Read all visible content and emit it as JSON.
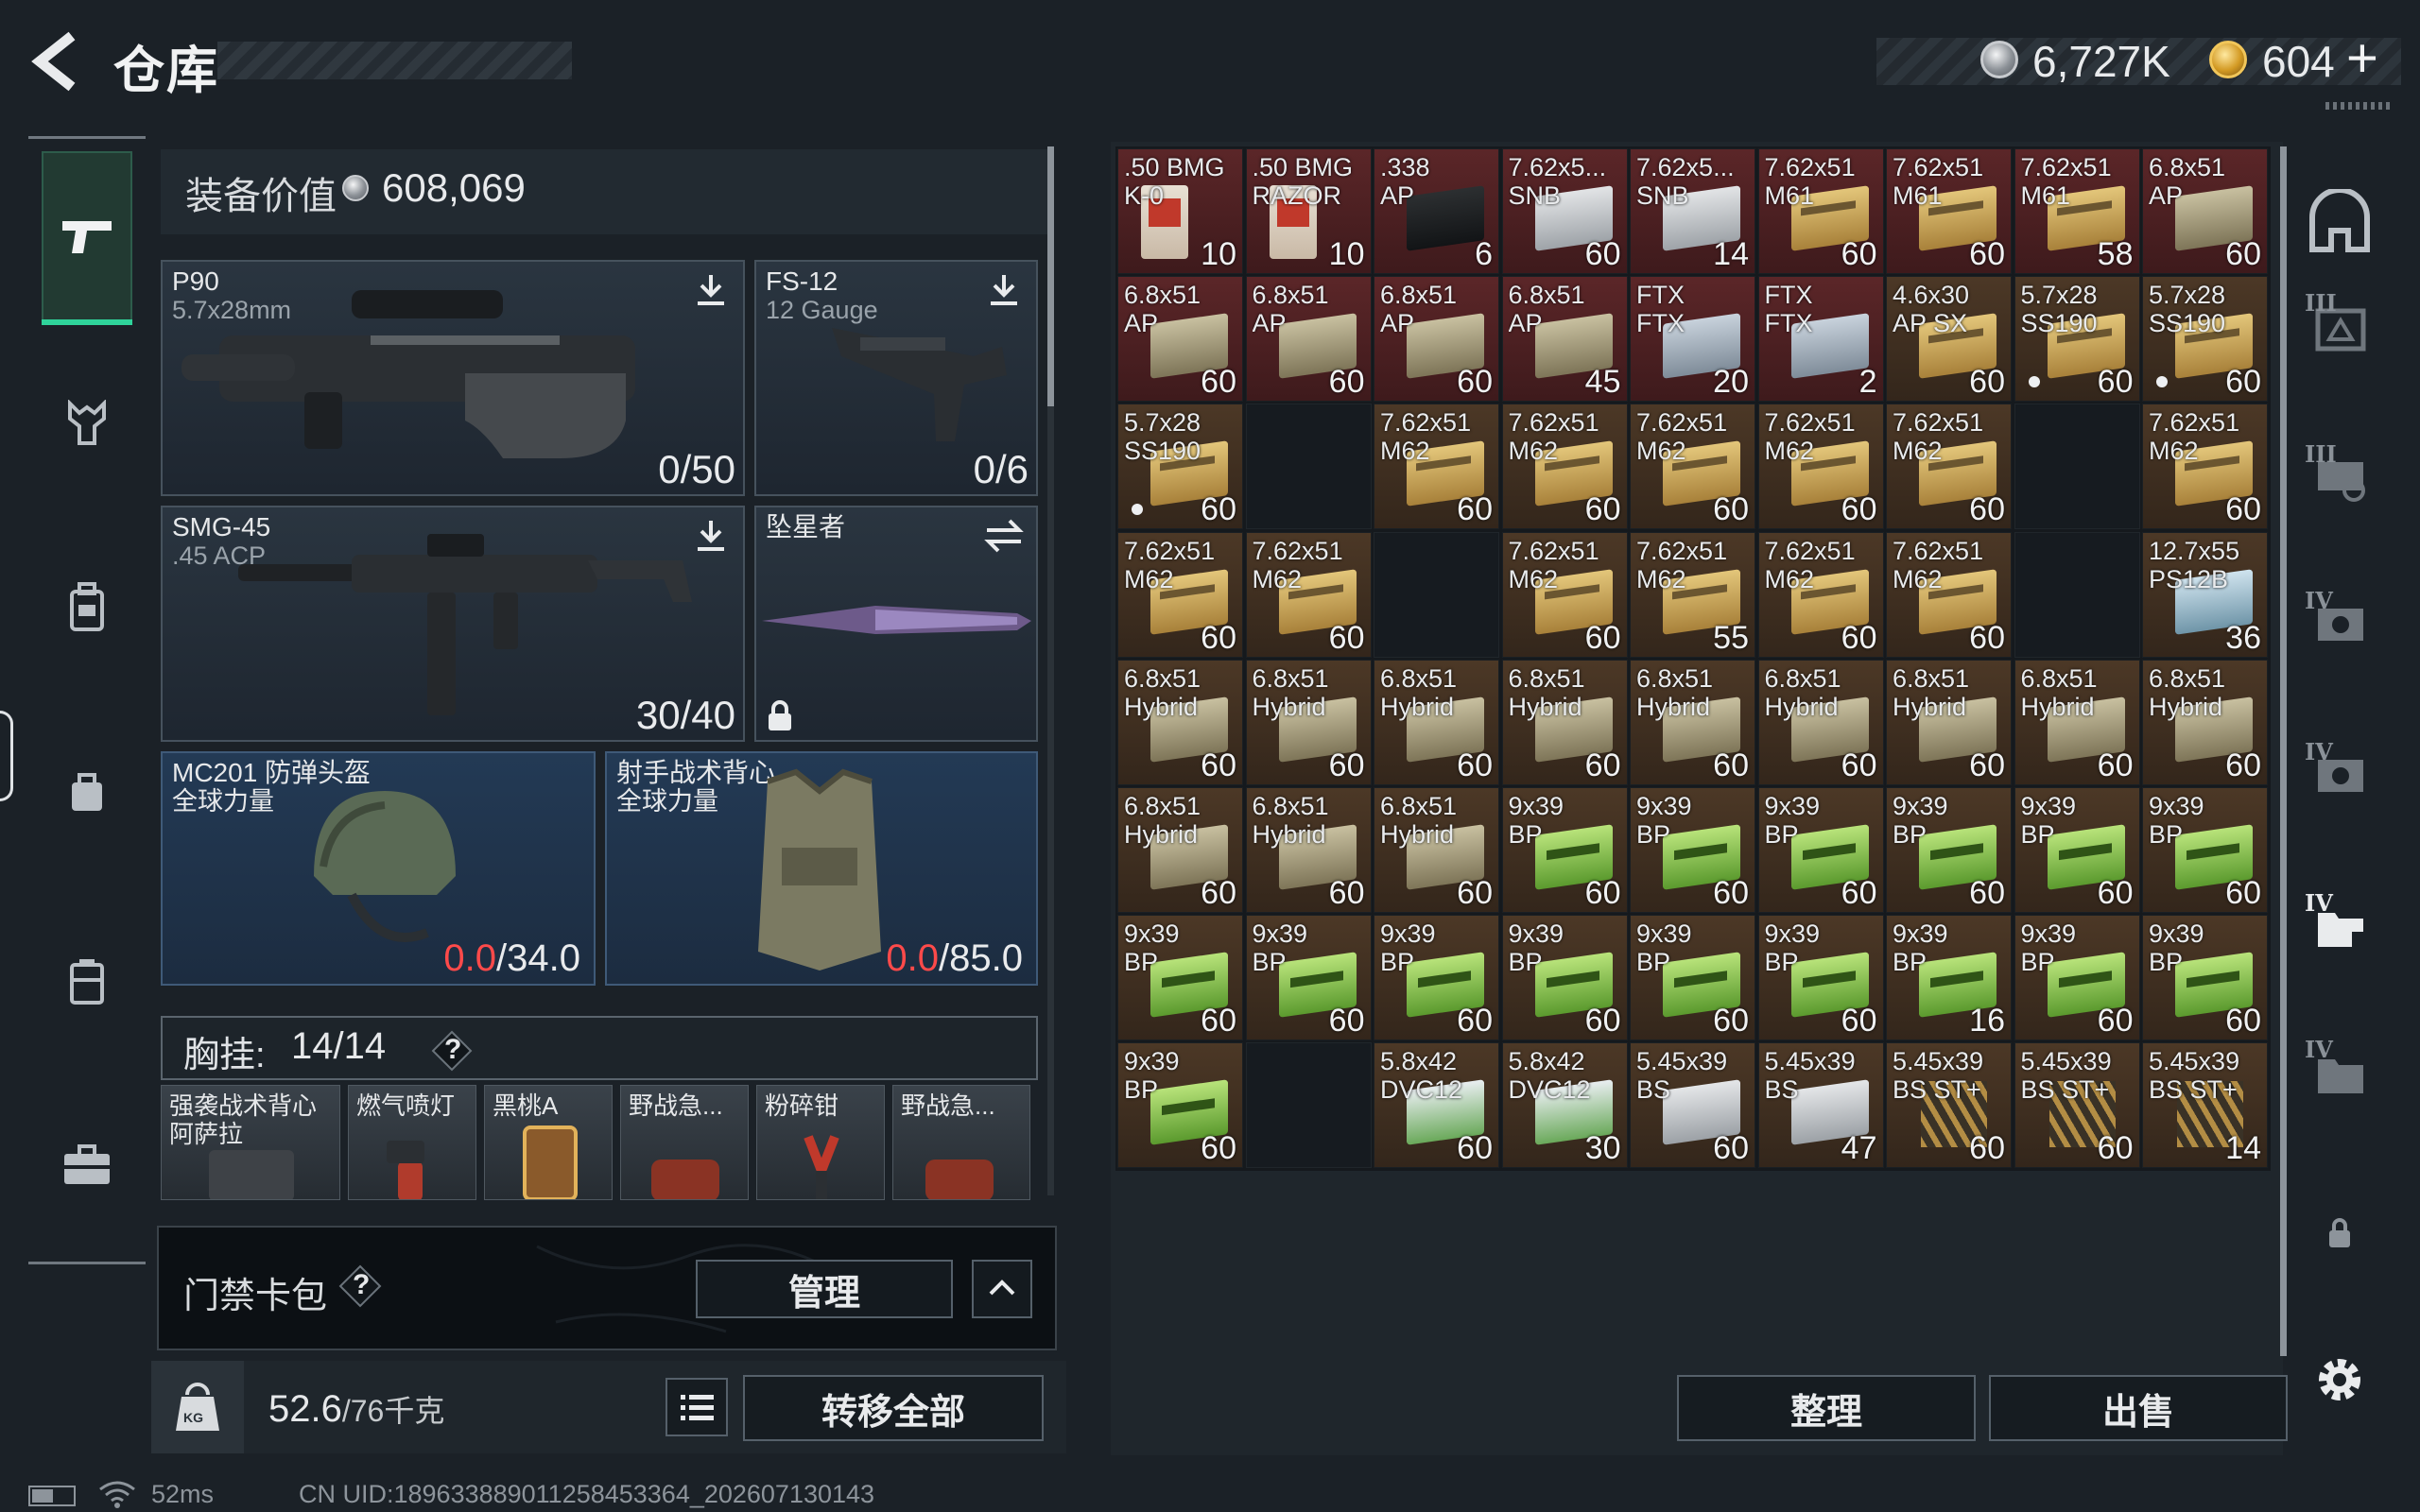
{
  "header": {
    "title": "仓库"
  },
  "currency": {
    "silver": "6,727K",
    "gold": "604",
    "add": "+"
  },
  "equipment": {
    "value_label": "装备价值",
    "value": "608,069",
    "primary": {
      "name": "P90",
      "sub": "5.7x28mm",
      "ammo": "0/50"
    },
    "secondary": {
      "name": "FS-12",
      "sub": "12 Gauge",
      "ammo": "0/6"
    },
    "pistol": {
      "name": "SMG-45",
      "sub": ".45 ACP",
      "ammo": "30/40"
    },
    "melee": {
      "name": "坠星者"
    },
    "helmet": {
      "name": "MC201 防弹头盔",
      "sub": "全球力量",
      "dur_cur": "0.0",
      "dur_max": "/34.0"
    },
    "armor": {
      "name": "射手战术背心",
      "sub": "全球力量",
      "dur_cur": "0.0",
      "dur_max": "/85.0"
    },
    "chest_rig": {
      "label": "胸挂:",
      "count": "14/14",
      "help": "?"
    },
    "rig_items": [
      {
        "label": "强袭战术背心",
        "sub": "阿萨拉"
      },
      {
        "label": "燃气喷灯",
        "sub": ""
      },
      {
        "label": "黑桃A",
        "sub": ""
      },
      {
        "label": "野战急...",
        "sub": ""
      },
      {
        "label": "粉碎钳",
        "sub": ""
      },
      {
        "label": "野战急...",
        "sub": ""
      }
    ]
  },
  "keycard": {
    "label": "门禁卡包",
    "help": "?",
    "manage": "管理"
  },
  "weight": {
    "current": "52.6",
    "max": "/76千克",
    "transfer_all": "转移全部",
    "kg_label": "KG"
  },
  "storage": {
    "sort": "整理",
    "sell": "出售",
    "rows": [
      [
        {
          "l1": ".50 BMG",
          "l2": "K-0",
          "n": "10",
          "bg": "red",
          "box": "bmg"
        },
        {
          "l1": ".50 BMG",
          "l2": "RAZOR",
          "n": "10",
          "bg": "red",
          "box": "bmg"
        },
        {
          "l1": ".338",
          "l2": "AP",
          "n": "6",
          "bg": "red",
          "box": "mag338"
        },
        {
          "l1": "7.62x5...",
          "l2": "SNB",
          "n": "60",
          "bg": "red",
          "box": "white"
        },
        {
          "l1": "7.62x5...",
          "l2": "SNB",
          "n": "14",
          "bg": "red",
          "box": "white"
        },
        {
          "l1": "7.62x51",
          "l2": "M61",
          "n": "60",
          "bg": "red",
          "box": "yellow"
        },
        {
          "l1": "7.62x51",
          "l2": "M61",
          "n": "60",
          "bg": "red",
          "box": "yellow"
        },
        {
          "l1": "7.62x51",
          "l2": "M61",
          "n": "58",
          "bg": "red",
          "box": "yellow"
        },
        {
          "l1": "6.8x51",
          "l2": "AP",
          "n": "60",
          "bg": "red",
          "box": "fabric"
        }
      ],
      [
        {
          "l1": "6.8x51",
          "l2": "AP",
          "n": "60",
          "bg": "red",
          "box": "fabric"
        },
        {
          "l1": "6.8x51",
          "l2": "AP",
          "n": "60",
          "bg": "red",
          "box": "fabric"
        },
        {
          "l1": "6.8x51",
          "l2": "AP",
          "n": "60",
          "bg": "red",
          "box": "fabric"
        },
        {
          "l1": "6.8x51",
          "l2": "AP",
          "n": "45",
          "bg": "red",
          "box": "fabric"
        },
        {
          "l1": "FTX",
          "l2": "FTX",
          "n": "20",
          "bg": "red",
          "box": "blueish"
        },
        {
          "l1": "FTX",
          "l2": "FTX",
          "n": "2",
          "bg": "red",
          "box": "blueish"
        },
        {
          "l1": "4.6x30",
          "l2": "AP SX",
          "n": "60",
          "bg": "brown",
          "box": "yellow"
        },
        {
          "l1": "5.7x28",
          "l2": "SS190",
          "n": "60",
          "bg": "brown",
          "box": "yellow",
          "dot": true
        },
        {
          "l1": "5.7x28",
          "l2": "SS190",
          "n": "60",
          "bg": "brown",
          "box": "yellow",
          "dot": true
        }
      ],
      [
        {
          "l1": "5.7x28",
          "l2": "SS190",
          "n": "60",
          "bg": "brown",
          "box": "yellow",
          "dot": true
        },
        {
          "empty": true
        },
        {
          "l1": "7.62x51",
          "l2": "M62",
          "n": "60",
          "bg": "brown",
          "box": "yellow"
        },
        {
          "l1": "7.62x51",
          "l2": "M62",
          "n": "60",
          "bg": "brown",
          "box": "yellow"
        },
        {
          "l1": "7.62x51",
          "l2": "M62",
          "n": "60",
          "bg": "brown",
          "box": "yellow"
        },
        {
          "l1": "7.62x51",
          "l2": "M62",
          "n": "60",
          "bg": "brown",
          "box": "yellow"
        },
        {
          "l1": "7.62x51",
          "l2": "M62",
          "n": "60",
          "bg": "brown",
          "box": "yellow"
        },
        {
          "empty": true
        },
        {
          "l1": "7.62x51",
          "l2": "M62",
          "n": "60",
          "bg": "brown",
          "box": "yellow"
        }
      ],
      [
        {
          "l1": "7.62x51",
          "l2": "M62",
          "n": "60",
          "bg": "brown",
          "box": "yellow"
        },
        {
          "l1": "7.62x51",
          "l2": "M62",
          "n": "60",
          "bg": "brown",
          "box": "yellow"
        },
        {
          "empty": true
        },
        {
          "l1": "7.62x51",
          "l2": "M62",
          "n": "60",
          "bg": "brown",
          "box": "yellow"
        },
        {
          "l1": "7.62x51",
          "l2": "M62",
          "n": "55",
          "bg": "brown",
          "box": "yellow"
        },
        {
          "l1": "7.62x51",
          "l2": "M62",
          "n": "60",
          "bg": "brown",
          "box": "yellow"
        },
        {
          "l1": "7.62x51",
          "l2": "M62",
          "n": "60",
          "bg": "brown",
          "box": "yellow"
        },
        {
          "empty": true
        },
        {
          "l1": "12.7x55",
          "l2": "PS12B",
          "n": "36",
          "bg": "brown",
          "box": "lightblue"
        }
      ],
      [
        {
          "l1": "6.8x51",
          "l2": "Hybrid",
          "n": "60",
          "bg": "brown",
          "box": "fabric"
        },
        {
          "l1": "6.8x51",
          "l2": "Hybrid",
          "n": "60",
          "bg": "brown",
          "box": "fabric"
        },
        {
          "l1": "6.8x51",
          "l2": "Hybrid",
          "n": "60",
          "bg": "brown",
          "box": "fabric"
        },
        {
          "l1": "6.8x51",
          "l2": "Hybrid",
          "n": "60",
          "bg": "brown",
          "box": "fabric"
        },
        {
          "l1": "6.8x51",
          "l2": "Hybrid",
          "n": "60",
          "bg": "brown",
          "box": "fabric"
        },
        {
          "l1": "6.8x51",
          "l2": "Hybrid",
          "n": "60",
          "bg": "brown",
          "box": "fabric"
        },
        {
          "l1": "6.8x51",
          "l2": "Hybrid",
          "n": "60",
          "bg": "brown",
          "box": "fabric"
        },
        {
          "l1": "6.8x51",
          "l2": "Hybrid",
          "n": "60",
          "bg": "brown",
          "box": "fabric"
        },
        {
          "l1": "6.8x51",
          "l2": "Hybrid",
          "n": "60",
          "bg": "brown",
          "box": "fabric"
        }
      ],
      [
        {
          "l1": "6.8x51",
          "l2": "Hybrid",
          "n": "60",
          "bg": "brown",
          "box": "fabric"
        },
        {
          "l1": "6.8x51",
          "l2": "Hybrid",
          "n": "60",
          "bg": "brown",
          "box": "fabric"
        },
        {
          "l1": "6.8x51",
          "l2": "Hybrid",
          "n": "60",
          "bg": "brown",
          "box": "fabric"
        },
        {
          "l1": "9x39",
          "l2": "BP",
          "n": "60",
          "bg": "brown",
          "box": "green"
        },
        {
          "l1": "9x39",
          "l2": "BP",
          "n": "60",
          "bg": "brown",
          "box": "green"
        },
        {
          "l1": "9x39",
          "l2": "BP",
          "n": "60",
          "bg": "brown",
          "box": "green"
        },
        {
          "l1": "9x39",
          "l2": "BP",
          "n": "60",
          "bg": "brown",
          "box": "green"
        },
        {
          "l1": "9x39",
          "l2": "BP",
          "n": "60",
          "bg": "brown",
          "box": "green"
        },
        {
          "l1": "9x39",
          "l2": "BP",
          "n": "60",
          "bg": "brown",
          "box": "green"
        }
      ],
      [
        {
          "l1": "9x39",
          "l2": "BP",
          "n": "60",
          "bg": "brown",
          "box": "green"
        },
        {
          "l1": "9x39",
          "l2": "BP",
          "n": "60",
          "bg": "brown",
          "box": "green"
        },
        {
          "l1": "9x39",
          "l2": "BP",
          "n": "60",
          "bg": "brown",
          "box": "green"
        },
        {
          "l1": "9x39",
          "l2": "BP",
          "n": "60",
          "bg": "brown",
          "box": "green"
        },
        {
          "l1": "9x39",
          "l2": "BP",
          "n": "60",
          "bg": "brown",
          "box": "green"
        },
        {
          "l1": "9x39",
          "l2": "BP",
          "n": "60",
          "bg": "brown",
          "box": "green"
        },
        {
          "l1": "9x39",
          "l2": "BP",
          "n": "16",
          "bg": "brown",
          "box": "green"
        },
        {
          "l1": "9x39",
          "l2": "BP",
          "n": "60",
          "bg": "brown",
          "box": "green"
        },
        {
          "l1": "9x39",
          "l2": "BP",
          "n": "60",
          "bg": "brown",
          "box": "green"
        }
      ],
      [
        {
          "l1": "9x39",
          "l2": "BP",
          "n": "60",
          "bg": "brown",
          "box": "green"
        },
        {
          "empty": true
        },
        {
          "l1": "5.8x42",
          "l2": "DVC12",
          "n": "60",
          "bg": "brown",
          "box": "greenwhite"
        },
        {
          "l1": "5.8x42",
          "l2": "DVC12",
          "n": "30",
          "bg": "brown",
          "box": "greenwhite"
        },
        {
          "l1": "5.45x39",
          "l2": "BS",
          "n": "60",
          "bg": "brown",
          "box": "silver"
        },
        {
          "l1": "5.45x39",
          "l2": "BS",
          "n": "47",
          "bg": "brown",
          "box": "silver"
        },
        {
          "l1": "5.45x39",
          "l2": "BS ST+",
          "n": "60",
          "bg": "brown",
          "box": "rounds"
        },
        {
          "l1": "5.45x39",
          "l2": "BS ST+",
          "n": "60",
          "bg": "brown",
          "box": "rounds"
        },
        {
          "l1": "5.45x39",
          "l2": "BS ST+",
          "n": "14",
          "bg": "brown",
          "box": "rounds"
        }
      ]
    ]
  },
  "right_nav": [
    {
      "tier": ""
    },
    {
      "tier": "III"
    },
    {
      "tier": "III"
    },
    {
      "tier": "IV"
    },
    {
      "tier": "IV"
    },
    {
      "tier": "IV"
    },
    {
      "tier": "IV"
    }
  ],
  "status": {
    "ping": "52ms",
    "uid": "CN UID:189633889011258453364_202607130143"
  }
}
